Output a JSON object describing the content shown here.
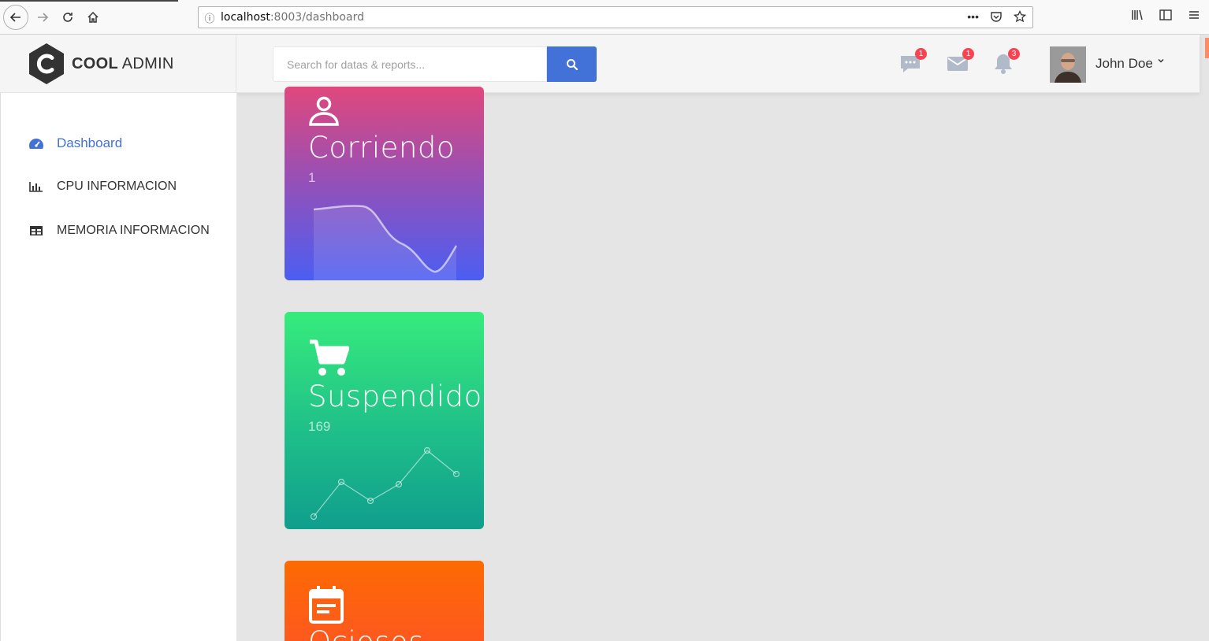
{
  "browser": {
    "url_host": "localhost",
    "url_path": ":8003/dashboard"
  },
  "app": {
    "logo_bold": "COOL",
    "logo_rest": " ADMIN"
  },
  "search": {
    "placeholder": "Search for datas & reports..."
  },
  "header": {
    "chat_badge": "1",
    "mail_badge": "1",
    "bell_badge": "3",
    "user_name": "John Doe"
  },
  "sidebar": {
    "items": [
      {
        "label": "Dashboard",
        "icon": "tachometer-icon",
        "active": true
      },
      {
        "label": "CPU INFORMACION",
        "icon": "bar-chart-icon",
        "active": false
      },
      {
        "label": "MEMORIA INFORMACION",
        "icon": "table-icon",
        "active": false
      }
    ]
  },
  "cards": [
    {
      "title": "Corriendo",
      "value": "1",
      "icon": "user-icon",
      "color_top": "#e0487c",
      "color_bottom": "#4b5ef2"
    },
    {
      "title": "Suspendidos",
      "value": "169",
      "icon": "cart-icon",
      "color_top": "#37ec7c",
      "color_bottom": "#109e8d"
    },
    {
      "title": "Ociosos",
      "value": "",
      "icon": "calendar-icon",
      "color_top": "#fd6a02",
      "color_bottom": "#fd5426"
    }
  ],
  "colors": {
    "accent": "#4272d7",
    "badge": "#fa4251"
  }
}
